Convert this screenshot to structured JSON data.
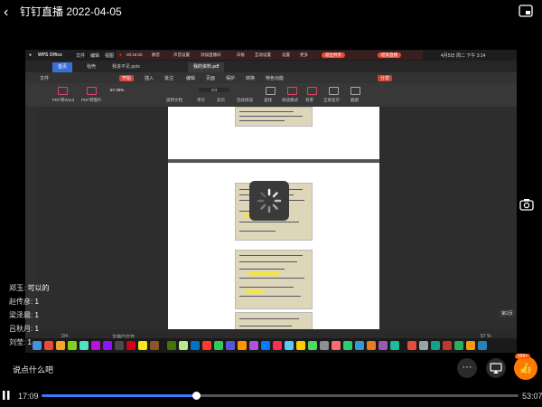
{
  "header": {
    "back_glyph": "‹",
    "title": "钉钉直播 2022-04-05"
  },
  "icons": {
    "pip": "pip-icon",
    "camera": "camera-icon",
    "more": "more-icon",
    "cast": "cast-icon",
    "like": "thumbs-up-icon"
  },
  "screen": {
    "mac_app": "WPS Office",
    "mac_menu": [
      "文件",
      "编辑",
      "视图"
    ],
    "mac_time": "4月5日 周二 下午 3:14",
    "rec_timer": "00:18:20",
    "rec_items": [
      "静音",
      "声音设置",
      "添加直播间",
      "白板",
      "互动设置",
      "设置",
      "更多"
    ],
    "exit_share": "退出共享",
    "end_live": "结束直播",
    "tabs": [
      "首页",
      "稻壳",
      "我进不见.pptx",
      "我的资料.pdf"
    ],
    "menus": [
      "文件",
      "开始",
      "插入",
      "批注",
      "编辑",
      "页面",
      "保护",
      "转换",
      "特色功能"
    ],
    "zoom": "57.30%",
    "page_field": "2/4",
    "share_label": "分享",
    "toolbar_items": [
      "PDF转Word",
      "PDF转图片",
      "旋转文档",
      "单页",
      "双页",
      "连续阅读",
      "查找",
      "阅读模式",
      "背景",
      "全屏显示",
      "截图"
    ],
    "status_page": "2/4",
    "status_note": "文档已打开",
    "status_zoom": "57 %",
    "page_badge": "第2页"
  },
  "chat": [
    {
      "user": "郑玉:",
      "text": "可以的"
    },
    {
      "user": "赵传彦:",
      "text": "1"
    },
    {
      "user": "梁泽晨:",
      "text": "1"
    },
    {
      "user": "吕秋月:",
      "text": "1"
    },
    {
      "user": "刘莹:",
      "text": "1"
    }
  ],
  "comment_prompt": "说点什么吧",
  "like_count": "999+",
  "player": {
    "current_time": "17:09",
    "total_time": "53:07",
    "progress": 0.323
  }
}
